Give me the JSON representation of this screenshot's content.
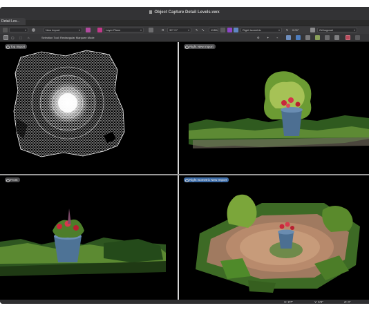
{
  "window": {
    "title": "Object Capture Detail Levels.vwx",
    "tab_label": "Detail Lev..."
  },
  "toolbar1": {
    "class_field": "New Import",
    "layer_field": "Layer Plane",
    "opacity_field": "30°+0°",
    "zoom_field": "113%",
    "view_field": "Right Isometric",
    "angle_field": "0.00°",
    "projection_field": "Orthogonal"
  },
  "toolbar2": {
    "mode_text": "Selection Tool: Rectangular Marquee Mode"
  },
  "viewports": [
    {
      "label": "Top  Import",
      "active": false
    },
    {
      "label": "Right  New Import",
      "active": false
    },
    {
      "label": "Front",
      "active": false
    },
    {
      "label": "Right Isometric  New Import",
      "active": true
    }
  ],
  "status": {
    "x": "X: 9'7\"",
    "y": "Y: 5'8\"",
    "z": "Z: 0\""
  },
  "colors": {
    "accent": "#3f6ea9",
    "viewport_bg": "#000000",
    "chrome": "#2b2b2b"
  },
  "icons": {
    "selection_tool": "arrow-icon",
    "lasso": "lasso-icon",
    "snap": "magnet-icon",
    "render": "render-icon",
    "layers": "layers-icon"
  }
}
